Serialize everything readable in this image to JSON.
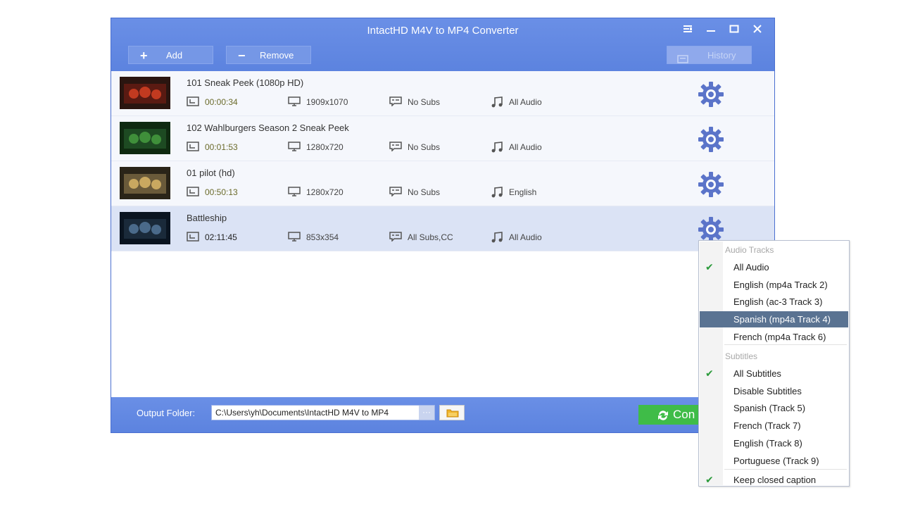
{
  "window": {
    "title": "IntactHD M4V to MP4 Converter",
    "controls": [
      "menu-icon",
      "minimize-icon",
      "maximize-icon",
      "close-icon"
    ]
  },
  "toolbar": {
    "add_label": "Add",
    "remove_label": "Remove",
    "history_label": "History"
  },
  "items": [
    {
      "name": "101 Sneak Peek (1080p HD)",
      "duration": "00:00:34",
      "resolution": "1909x1070",
      "subs": "No Subs",
      "audio": "All Audio"
    },
    {
      "name": "102 Wahlburgers Season 2 Sneak Peek",
      "duration": "00:01:53",
      "resolution": "1280x720",
      "subs": "No Subs",
      "audio": "All Audio"
    },
    {
      "name": "01 pilot (hd)",
      "duration": "00:50:13",
      "resolution": "1280x720",
      "subs": "No Subs",
      "audio": "English"
    },
    {
      "name": "Battleship",
      "duration": "02:11:45",
      "resolution": "853x354",
      "subs": "All Subs,CC",
      "audio": "All Audio"
    }
  ],
  "footer": {
    "output_label": "Output Folder:",
    "output_path": "C:\\Users\\yh\\Documents\\IntactHD M4V to MP4",
    "browse_dots": "···",
    "convert_label": "Con"
  },
  "dropdown": {
    "audio_header": "Audio Tracks",
    "audio_tracks": [
      {
        "label": "All Audio",
        "checked": true
      },
      {
        "label": "English (mp4a Track 2)",
        "checked": false
      },
      {
        "label": "English (ac-3 Track 3)",
        "checked": false
      },
      {
        "label": "Spanish (mp4a Track 4)",
        "checked": false,
        "highlighted": true
      },
      {
        "label": "French (mp4a Track 6)",
        "checked": false
      }
    ],
    "subtitles_header": "Subtitles",
    "subtitles": [
      {
        "label": "All Subtitles",
        "checked": true
      },
      {
        "label": "Disable Subtitles",
        "checked": false
      },
      {
        "label": "Spanish (Track 5)",
        "checked": false
      },
      {
        "label": "French (Track 7)",
        "checked": false
      },
      {
        "label": "English (Track 8)",
        "checked": false
      },
      {
        "label": "Portuguese (Track 9)",
        "checked": false
      }
    ],
    "keep_cc": {
      "label": "Keep closed caption",
      "checked": true
    }
  }
}
